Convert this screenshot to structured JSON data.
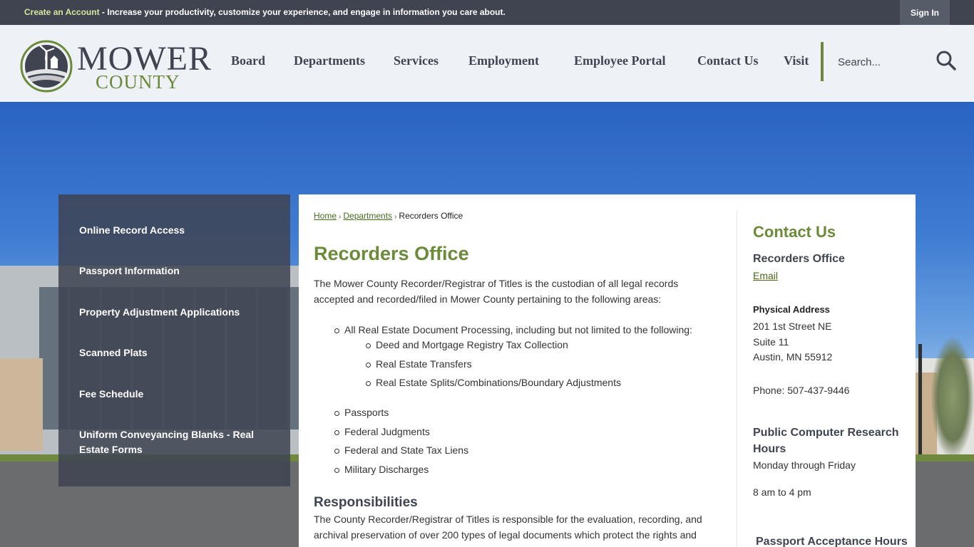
{
  "topbar": {
    "create_account": "Create an Account",
    "message": " - Increase your productivity, customize your experience, and engage in information you care about.",
    "sign_in": "Sign In"
  },
  "logo": {
    "line1": "MOWER",
    "line2": "COUNTY"
  },
  "nav": [
    "Board",
    "Departments",
    "Services",
    "Employment",
    "Employee Portal",
    "Contact Us",
    "Visit"
  ],
  "search": {
    "placeholder": "Search..."
  },
  "sidebar": [
    "Online Record Access",
    "Passport Information",
    "Property Adjustment Applications",
    "Scanned Plats",
    "Fee Schedule",
    "Uniform Conveyancing Blanks - Real Estate Forms"
  ],
  "breadcrumb": {
    "home": "Home",
    "departments": "Departments",
    "current": "Recorders Office"
  },
  "main": {
    "title": "Recorders Office",
    "intro": "The Mower County Recorder/Registrar of Titles is the custodian of all legal records accepted and recorded/filed in Mower County pertaining to the following areas:",
    "list": {
      "real_estate": "All Real Estate Document Processing, including but not limited to the following:",
      "sub": [
        "Deed and Mortgage Registry Tax Collection",
        "Real Estate Transfers",
        "Real Estate Splits/Combinations/Boundary Adjustments"
      ],
      "others": [
        "Passports",
        "Federal Judgments",
        "Federal and State Tax Liens",
        "Military Discharges"
      ]
    },
    "responsibilities_title": "Responsibilities",
    "responsibilities_text": "The County Recorder/Registrar of Titles is responsible for the evaluation, recording, and archival preservation of over 200 types of legal documents which protect the rights and interests of individuals and institutions. The County Recorder's Office is a public"
  },
  "contact": {
    "title": "Contact Us",
    "office": "Recorders Office",
    "email": "Email",
    "address_label": "Physical Address",
    "address": [
      "201 1st Street NE",
      "Suite 11",
      "Austin, MN 55912"
    ],
    "phone": "Phone: 507-437-9446",
    "hours_title": "Public Computer Research Hours",
    "hours_days": "Monday through Friday",
    "hours_time": "8 am to 4 pm",
    "passport_title": "Passport Acceptance Hours"
  }
}
